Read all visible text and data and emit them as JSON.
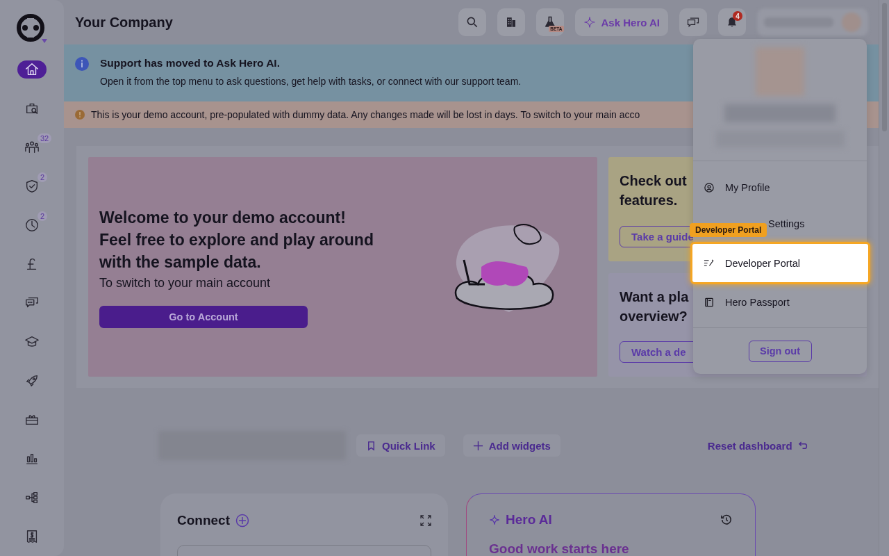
{
  "sidebar": {
    "items": [
      {
        "kind": "home",
        "selected": true
      },
      {
        "kind": "briefcase",
        "selected": false
      },
      {
        "kind": "people",
        "selected": false,
        "badge": "32"
      },
      {
        "kind": "shield",
        "selected": false,
        "badge": "2"
      },
      {
        "kind": "clock",
        "selected": false,
        "badge": "2"
      },
      {
        "kind": "pound",
        "selected": false
      },
      {
        "kind": "chat",
        "selected": false
      },
      {
        "kind": "cap",
        "selected": false
      },
      {
        "kind": "rocket",
        "selected": false
      },
      {
        "kind": "gift",
        "selected": false
      },
      {
        "kind": "chart",
        "selected": false
      },
      {
        "kind": "tree",
        "selected": false
      },
      {
        "kind": "receipt",
        "selected": false
      }
    ]
  },
  "header": {
    "title": "Your Company",
    "lab_badge": "BETA",
    "ask_ai": "Ask Hero AI",
    "notifications": "4"
  },
  "info_banner": {
    "title": "Support has moved to Ask Hero AI.",
    "text": "Open it from the top menu to ask questions, get help with tasks, or connect with our support team."
  },
  "demo_banner": {
    "text": "This is your demo account, pre-populated with dummy data. Any changes made will be lost in days. To switch to your main acco"
  },
  "welcome": {
    "heading_lines": [
      "Welcome to your demo account!",
      "Feel free to explore and play around",
      "with the sample data."
    ],
    "subtitle": "To switch to your main account",
    "button": "Go to Account"
  },
  "side_cards": [
    {
      "heading_lines": [
        "Check out",
        "features."
      ],
      "button": "Take a guide"
    },
    {
      "heading_lines": [
        "Want a pla",
        "overview?"
      ],
      "button": "Watch a de"
    }
  ],
  "profile_menu": {
    "items": [
      {
        "kind": "profile",
        "label": "My Profile",
        "selected": false
      },
      {
        "kind": "settings",
        "label": "Settings",
        "selected": false
      },
      {
        "kind": "developer",
        "label": "Developer Portal",
        "selected": true
      },
      {
        "kind": "passport",
        "label": "Hero Passport",
        "selected": false
      }
    ],
    "sign_out": "Sign out",
    "tooltip": "Developer Portal"
  },
  "dashboard_toolbar": {
    "quick_link": "Quick Link",
    "add_widgets": "Add widgets",
    "reset": "Reset dashboard"
  },
  "widgets": [
    {
      "kind": "connect",
      "title": "Connect"
    },
    {
      "kind": "ai",
      "title": "Hero AI",
      "subtitle": "Good work starts here"
    }
  ]
}
